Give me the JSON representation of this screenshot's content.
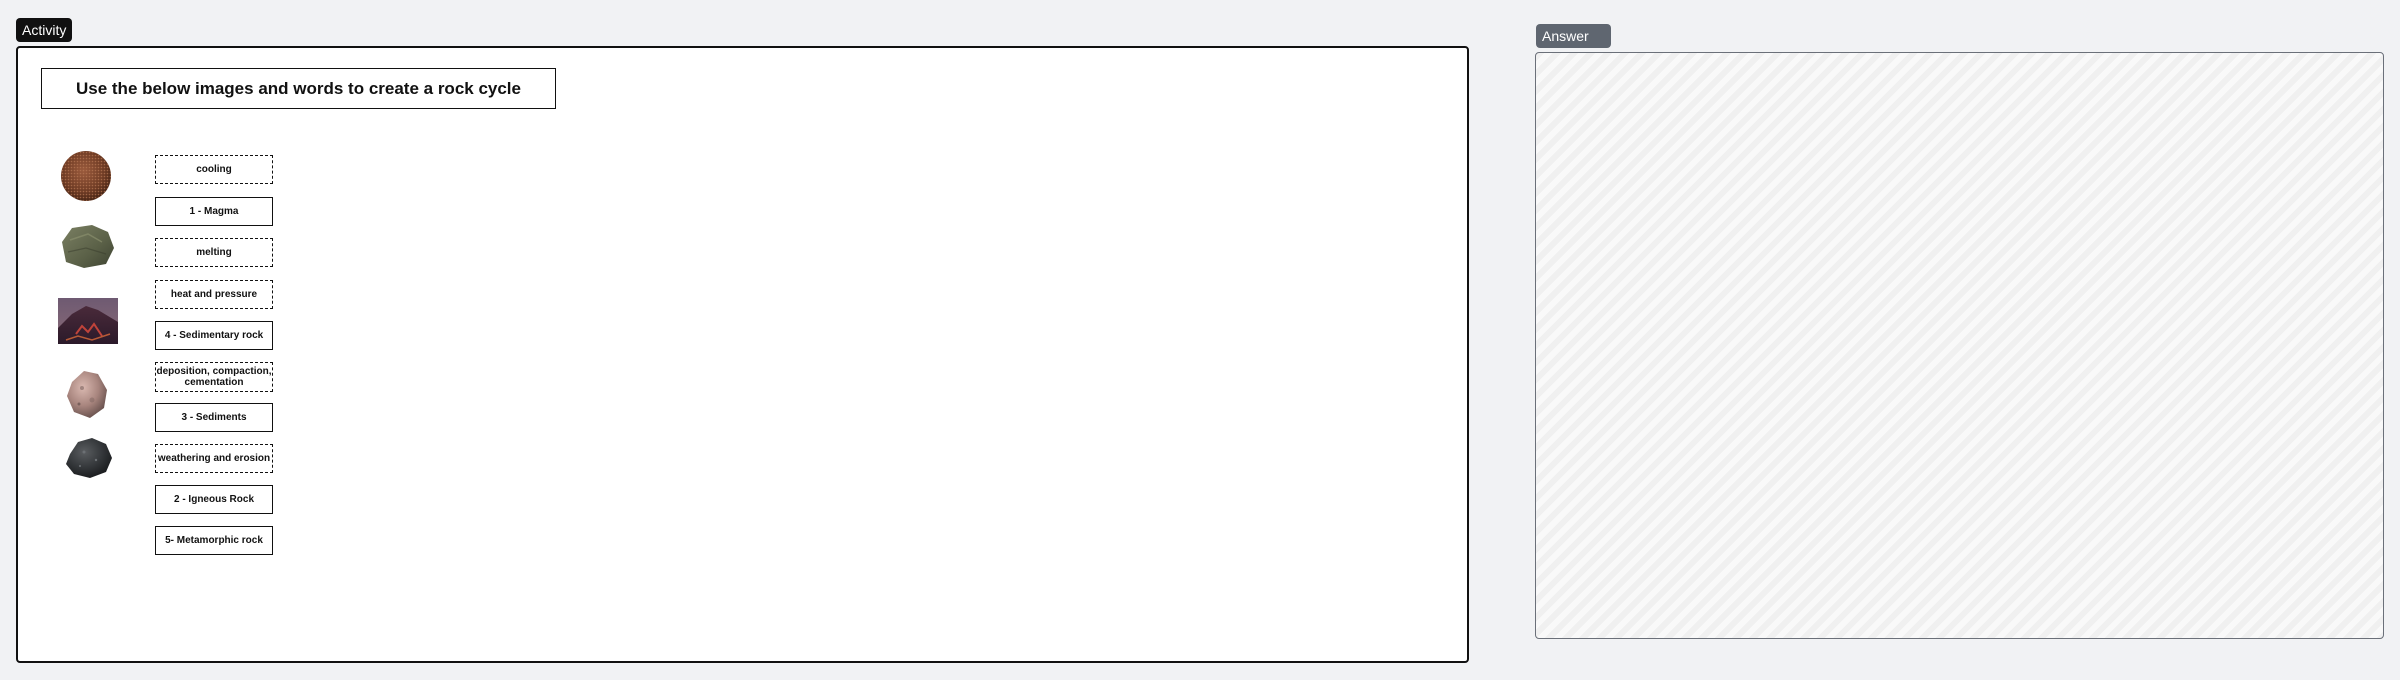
{
  "tabs": {
    "activity": "Activity",
    "answer": "Answer"
  },
  "activity": {
    "title": "Use the below images and words to create a rock cycle",
    "images": [
      {
        "name": "sediments-rock-icon"
      },
      {
        "name": "metamorphic-rock-icon"
      },
      {
        "name": "magma-lava-icon"
      },
      {
        "name": "sedimentary-rock-icon"
      },
      {
        "name": "igneous-rock-icon"
      }
    ],
    "cards": [
      {
        "label": "cooling",
        "style": "dashed"
      },
      {
        "label": "1 - Magma",
        "style": "solid"
      },
      {
        "label": "melting",
        "style": "dashed"
      },
      {
        "label": "heat and pressure",
        "style": "dashed"
      },
      {
        "label": "4 - Sedimentary rock",
        "style": "solid"
      },
      {
        "label": "deposition, compaction, cementation",
        "style": "dashed"
      },
      {
        "label": "3 - Sediments",
        "style": "solid"
      },
      {
        "label": "weathering and erosion",
        "style": "dashed"
      },
      {
        "label": "2 - Igneous Rock",
        "style": "solid"
      },
      {
        "label": "5- Metamorphic rock",
        "style": "solid"
      }
    ]
  },
  "colors": {
    "activity_tab_bg": "#111111",
    "answer_tab_bg": "#5f6670",
    "page_bg": "#f1f2f4"
  }
}
